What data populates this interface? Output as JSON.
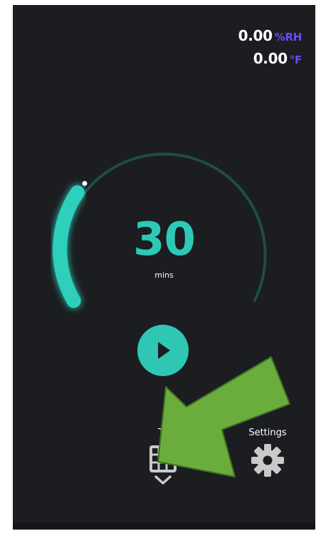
{
  "readings": {
    "humidity_value": "0.00",
    "humidity_unit": "%RH",
    "temperature_value": "0.00",
    "temperature_unit": "°F"
  },
  "timer": {
    "value": "30",
    "unit": "mins"
  },
  "nav": {
    "temp_label": "Te",
    "settings_label": "Settings"
  },
  "colors": {
    "accent": "#2fc7b3",
    "unit_accent": "#6c4bff",
    "background": "#1b1d20",
    "arrow": "#6aad3d"
  },
  "icons": {
    "play": "play-icon",
    "temperature_list": "table-chevron-icon",
    "settings": "gear-icon",
    "annotation": "arrow-annotation"
  }
}
